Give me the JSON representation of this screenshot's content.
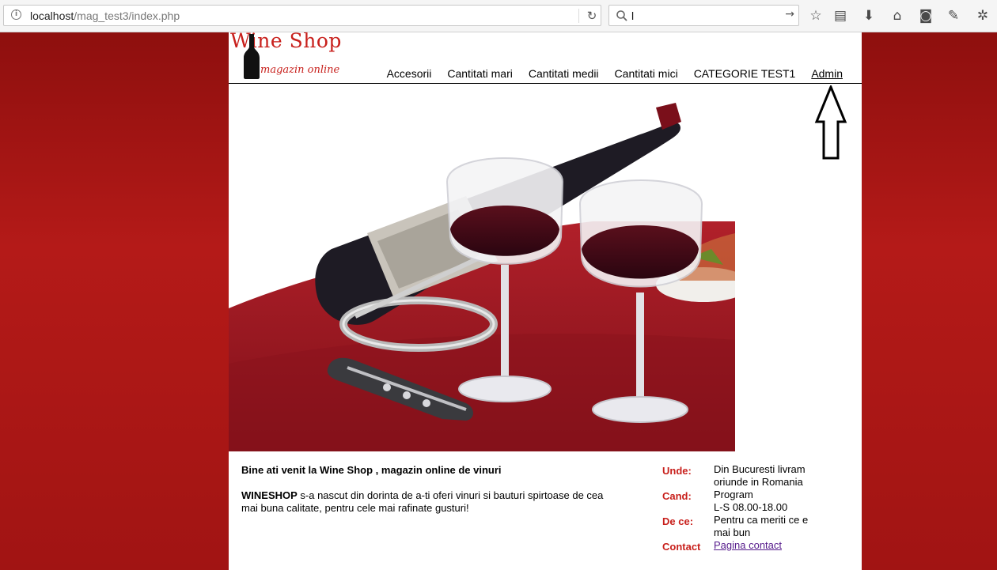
{
  "browser": {
    "url_host": "localhost",
    "url_path": "/mag_test3/index.php",
    "search_value": "l",
    "toolbar_icons": [
      "star-icon",
      "reading-list-icon",
      "download-icon",
      "home-icon",
      "pocket-icon",
      "pen-icon",
      "extension-icon"
    ]
  },
  "logo": {
    "title": "Wine Shop",
    "subtitle": "magazin online"
  },
  "nav": {
    "items": [
      "Accesorii",
      "Cantitati mari",
      "Cantitati medii",
      "Cantitati mici",
      "CATEGORIE TEST1",
      "Admin"
    ]
  },
  "content": {
    "welcome": "Bine ati venit la Wine Shop , magazin online de vinuri",
    "intro_brand": "WINESHOP",
    "intro_text": " s-a nascut din dorinta de a-ti oferi vinuri si bauturi spirtoase de cea mai buna calitate, pentru cele mai rafinate gusturi!"
  },
  "info": {
    "where_label": "Unde:",
    "where_value": "Din Bucuresti livram oriunde in Romania",
    "when_label": "Cand:",
    "when_value_1": "Program",
    "when_value_2": "L-S 08.00-18.00",
    "why_label": "De ce:",
    "why_value": "Pentru ca meriti ce e mai bun",
    "contact_label": "Contact",
    "contact_link": "Pagina contact"
  },
  "colors": {
    "brand_red": "#c8201c",
    "background_red": "#a11413"
  }
}
